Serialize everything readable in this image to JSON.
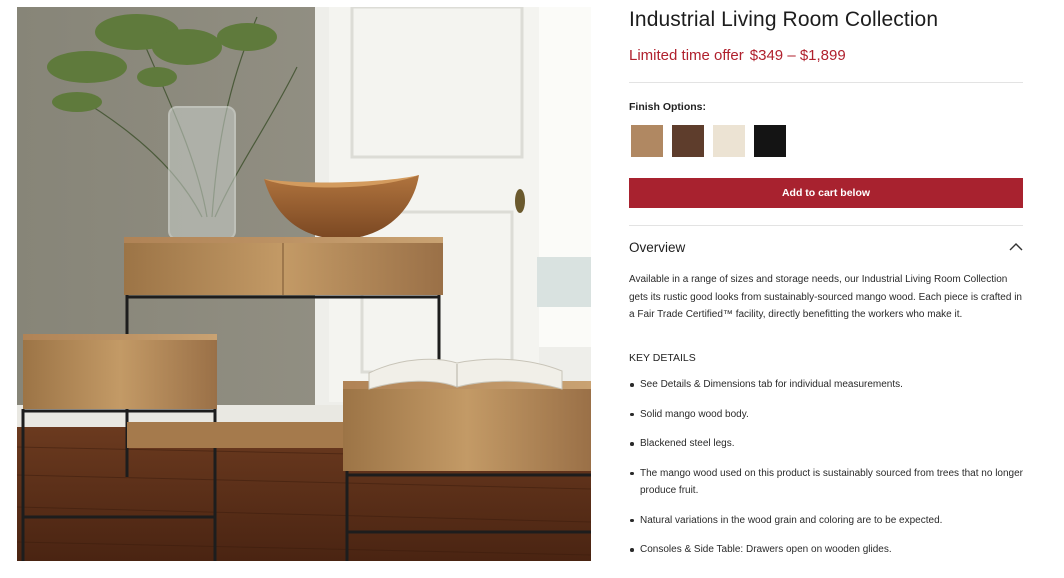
{
  "product": {
    "title": "Industrial Living Room Collection",
    "offer_label": "Limited time offer",
    "price_range": "$349 – $1,899"
  },
  "finish": {
    "label": "Finish Options:",
    "swatches": [
      {
        "name": "natural-mango",
        "color": "#b08862"
      },
      {
        "name": "walnut",
        "color": "#5e3d2c"
      },
      {
        "name": "whitewash",
        "color": "#ece3d3"
      },
      {
        "name": "black",
        "color": "#141414"
      }
    ]
  },
  "cart": {
    "button_label": "Add to cart below"
  },
  "overview": {
    "title": "Overview",
    "expanded_icon": "chevron-up-icon",
    "description": "Available in a range of sizes and storage needs, our Industrial Living Room Collection gets its rustic good looks from sustainably-sourced mango wood. Each piece is crafted in a Fair Trade Certified™ facility, directly benefitting the workers who make it.",
    "key_details_heading": "KEY DETAILS",
    "key_details": [
      "See Details & Dimensions tab for individual measurements.",
      "Solid mango wood body.",
      "Blackened steel legs.",
      "The mango wood used on this product is sustainably sourced from trees that no longer produce fruit.",
      "Natural variations in the wood grain and coloring are to be expected.",
      "Consoles & Side Table: Drawers open on wooden glides."
    ]
  },
  "colors": {
    "accent": "#a8222f",
    "price": "#b0202d"
  }
}
